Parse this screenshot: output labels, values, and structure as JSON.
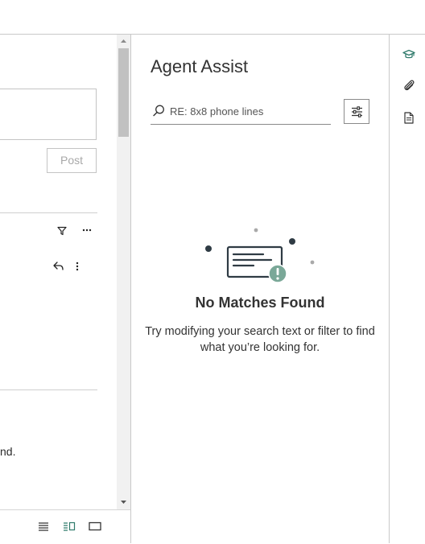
{
  "colors": {
    "accent": "#2f7a6b",
    "illustration_dark": "#2f3b44",
    "illustration_badge": "#7aa898",
    "border": "#c4c4c4"
  },
  "left_pane": {
    "post_button_label": "Post",
    "trailing_text": "nd.",
    "icons": [
      "filter-icon",
      "more-icon",
      "reply-icon",
      "more-vertical-icon"
    ]
  },
  "bottom_toolbar": {
    "icons": [
      "list-view-icon",
      "split-view-icon",
      "single-view-icon"
    ],
    "active": "split-view-icon"
  },
  "agent_assist": {
    "title": "Agent Assist",
    "search": {
      "value": "",
      "placeholder": "RE: 8x8 phone lines"
    },
    "empty_state": {
      "title": "No Matches Found",
      "description": "Try modifying your search text or filter to find what you’re looking for."
    }
  },
  "right_rail": {
    "icons": [
      "graduation-cap-icon",
      "paperclip-icon",
      "document-icon"
    ],
    "active": "graduation-cap-icon"
  }
}
